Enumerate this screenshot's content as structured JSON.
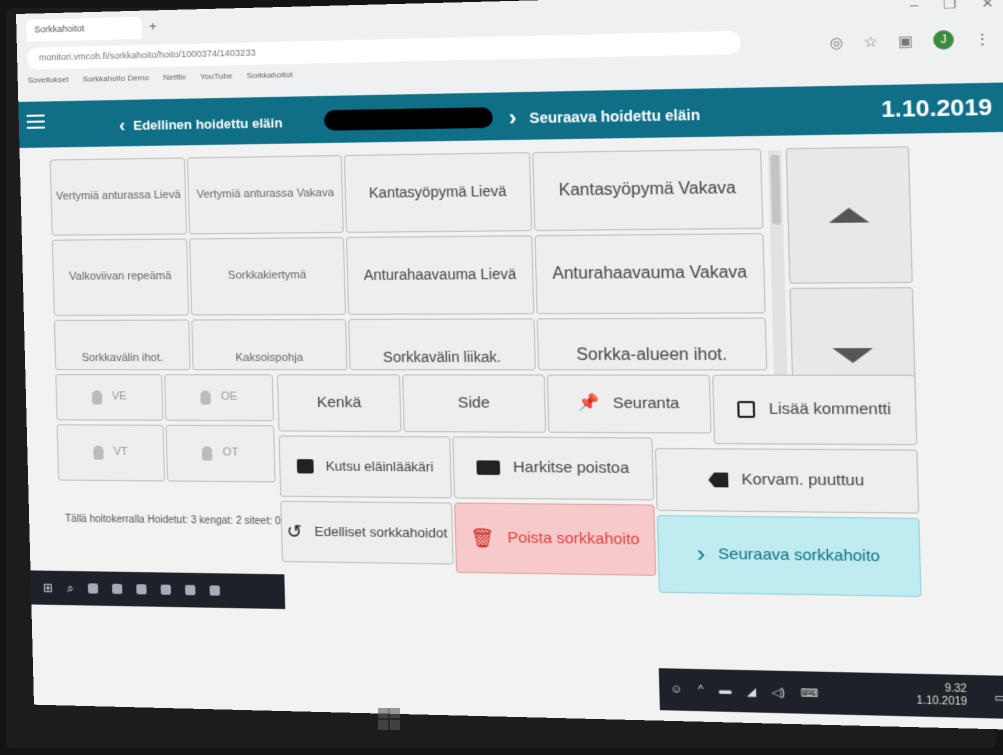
{
  "browser": {
    "tab_title": "Sorkkahoitot",
    "url": "monitori.vmcoh.fi/sorkkahoito/hoito/1000374/1403233",
    "bookmarks": [
      "Sovellukset",
      "Sorkkahoito Demo",
      "Netflix",
      "YouTube",
      "Sorkkahoitot"
    ]
  },
  "header": {
    "prev_label": "Edellinen hoidettu eläin",
    "next_label": "Seuraava hoidettu eläin",
    "date": "1.10.2019"
  },
  "conditions": [
    {
      "label": "Vertymiä anturassa Lievä"
    },
    {
      "label": "Vertymiä anturassa Vakava"
    },
    {
      "label": "Kantasyöpymä Lievä"
    },
    {
      "label": "Kantasyöpymä Vakava"
    },
    {
      "label": "Valkoviivan repeämä"
    },
    {
      "label": "Sorkkakiertymä"
    },
    {
      "label": "Anturahaavauma Lievä"
    },
    {
      "label": "Anturahaavauma Vakava"
    },
    {
      "label": "Sorkkavälin ihot."
    },
    {
      "label": "Kaksoispohja"
    },
    {
      "label": "Sorkkavälin liikak."
    },
    {
      "label": "Sorkka-alueen ihot."
    }
  ],
  "quadrants": [
    "VE",
    "OE",
    "VT",
    "OT"
  ],
  "actions": {
    "kenka": "Kenkä",
    "side": "Side",
    "seuranta": "Seuranta",
    "lisaa_kommentti": "Lisää kommentti",
    "kutsu": "Kutsu eläinlääkäri",
    "harkitse": "Harkitse poistoa",
    "korvam": "Korvam. puuttuu",
    "edelliset": "Edelliset sorkkahoidot",
    "poista": "Poista sorkkahoito",
    "seuraava": "Seuraava sorkkahoito"
  },
  "status": "Tällä hoitokerralla Hoidetut: 3 kengat: 2 siteet: 0",
  "taskbar": {
    "time": "9.32",
    "date": "1.10.2019"
  },
  "colors": {
    "header": "#0f6f86",
    "danger_bg": "#f6caca",
    "next_bg": "#bfecf0"
  }
}
